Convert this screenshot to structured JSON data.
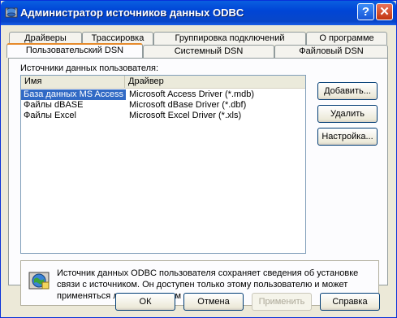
{
  "window": {
    "title": "Администратор источников данных ODBC",
    "help_label": "?",
    "close_label": "✕"
  },
  "tabs": {
    "row1": [
      "Драйверы",
      "Трассировка",
      "Группировка подключений",
      "О программе"
    ],
    "row2": [
      "Пользовательский DSN",
      "Системный DSN",
      "Файловый DSN"
    ],
    "active": "Пользовательский DSN"
  },
  "main": {
    "group_label": "Источники данных пользователя:",
    "columns": [
      "Имя",
      "Драйвер"
    ],
    "rows": [
      {
        "name": "База данных MS Access",
        "driver": "Microsoft Access Driver (*.mdb)",
        "selected": true
      },
      {
        "name": "Файлы dBASE",
        "driver": "Microsoft dBase Driver (*.dbf)",
        "selected": false
      },
      {
        "name": "Файлы Excel",
        "driver": "Microsoft Excel Driver (*.xls)",
        "selected": false
      }
    ],
    "buttons": {
      "add": "Добавить...",
      "remove": "Удалить",
      "configure": "Настройка..."
    },
    "info_text": "Источник данных ODBC пользователя сохраняет сведения об установке связи с источником. Он доступен только этому пользователю и может применяться лишь на данном компьютере."
  },
  "footer": {
    "ok": "ОК",
    "cancel": "Отмена",
    "apply": "Применить",
    "help": "Справка"
  },
  "colors": {
    "title_bar": "#0045d6",
    "selection": "#316ac5",
    "tab_highlight": "#e68b2c",
    "dialog_bg": "#ece9d8"
  },
  "icons": {
    "title": "odbc-icon",
    "info": "globe-database-icon"
  }
}
